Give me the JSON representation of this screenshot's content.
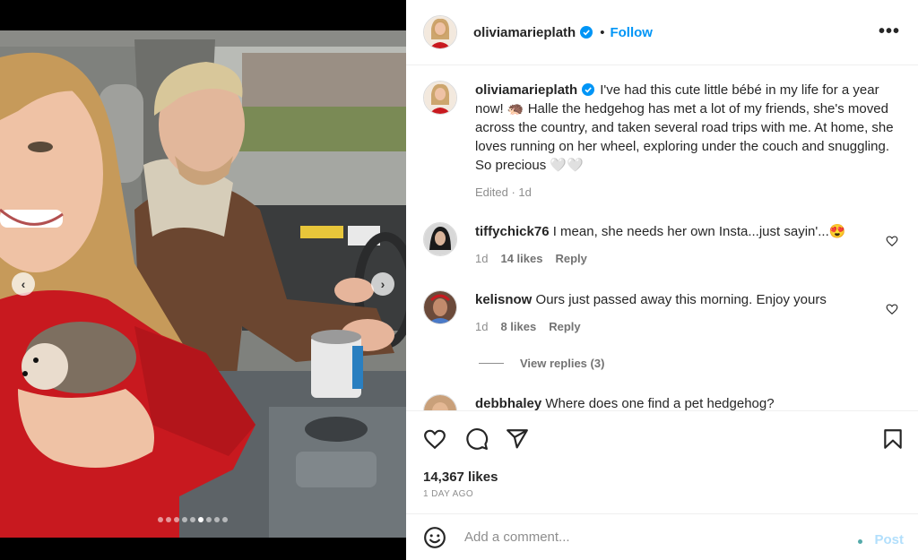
{
  "header": {
    "username": "oliviamarieplath",
    "separator": "•",
    "follow_label": "Follow",
    "more_label": "•••"
  },
  "caption": {
    "username": "oliviamarieplath",
    "text": "I've had this cute little bébé in my life for a year now! 🦔 Halle the hedgehog has met a lot of my friends, she's moved across the country, and taken several road trips with me. At home, she loves running on her wheel, exploring under the couch and snuggling. So precious 🤍🤍",
    "meta": "Edited · 1d"
  },
  "comments": [
    {
      "username": "tiffychick76",
      "text": "I mean, she needs her own Insta...just sayin'...😍",
      "time": "1d",
      "likes": "14 likes",
      "reply": "Reply"
    },
    {
      "username": "kelisnow",
      "text": "Ours just passed away this morning. Enjoy yours",
      "time": "1d",
      "likes": "8 likes",
      "reply": "Reply"
    },
    {
      "username": "debbhaley",
      "text": "Where does one find a pet hedgehog?"
    }
  ],
  "view_replies": "View replies (3)",
  "actions": {
    "likes": "14,367 likes",
    "time_ago": "1 DAY AGO"
  },
  "comment_bar": {
    "placeholder": "Add a comment...",
    "post_label": "Post"
  },
  "carousel": {
    "prev": "‹",
    "next": "›",
    "slide_count": 9,
    "active_index": 5
  },
  "colors": {
    "accent": "#0095f6",
    "post_disabled": "#b2dffc",
    "muted": "#8e8e8e",
    "sweater": "#c8191f"
  }
}
